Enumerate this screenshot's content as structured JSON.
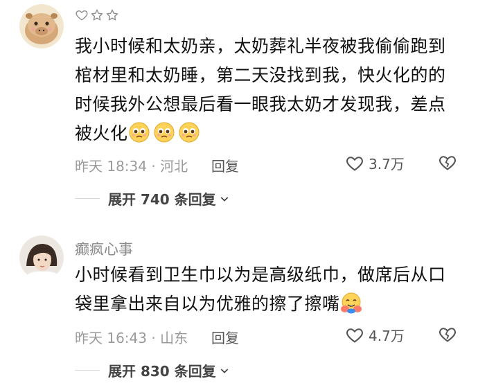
{
  "comments": [
    {
      "rating_icons": [
        "heart-outline-icon",
        "star-outline-icon",
        "star-outline-icon"
      ],
      "text": "我小时候和太奶亲，太奶葬礼半夜被我偷偷跑到棺材里和太奶睡，第二天没找到我，快火化的的时候我外公想最后看一眼我太奶才发现我，差点被火化",
      "emojis": [
        "pleading-face-emoji",
        "pleading-face-emoji",
        "pleading-face-emoji"
      ],
      "time_location": "昨天 18:34 · 河北",
      "reply_label": "回复",
      "likes": "3.7万",
      "expand_label": "展开 740 条回复"
    },
    {
      "username": "癫疯心事",
      "text": "小时候看到卫生巾以为是高级纸巾，做席后从口袋里拿出来自以为优雅的擦了擦嘴",
      "emojis": [
        "hugging-face-emoji"
      ],
      "time_location": "昨天 16:43 · 山东",
      "reply_label": "回复",
      "likes": "4.7万",
      "expand_label": "展开 830 条回复"
    }
  ],
  "colors": {
    "text": "#111111",
    "meta": "#9a9a9a",
    "icon": "#555555"
  }
}
